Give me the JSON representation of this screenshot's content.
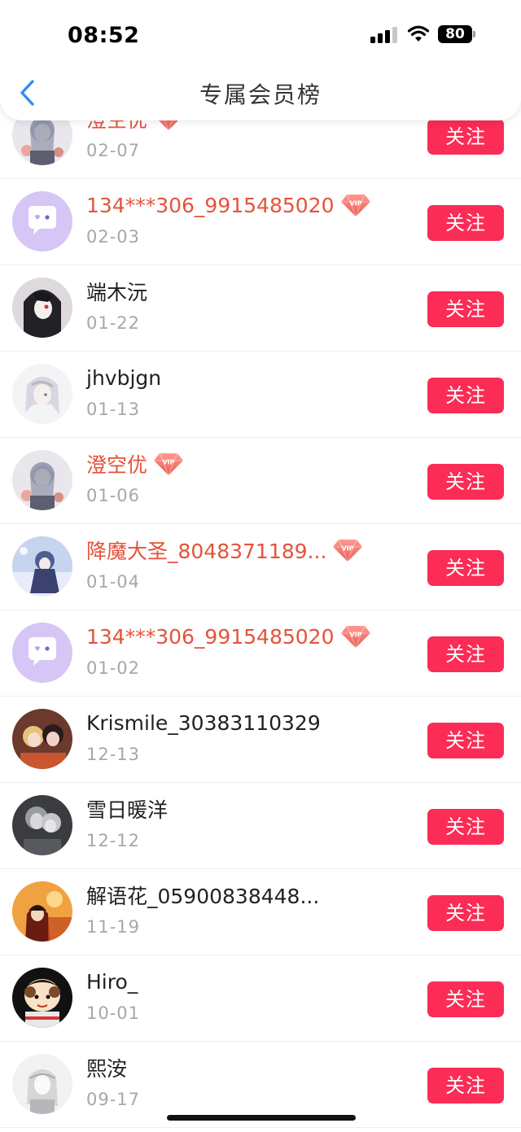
{
  "status_bar": {
    "time": "08:52",
    "battery": "80"
  },
  "header": {
    "title": "专属会员榜"
  },
  "follow_label": "关注",
  "vip_badge_text": "VIP",
  "colors": {
    "accent": "#fb2c55",
    "vip_name": "#e5533a",
    "back_arrow": "#2f8ff0"
  },
  "members": [
    {
      "name": "澄空优",
      "date": "02-07",
      "vip": true,
      "avatar": "anime-girl-silver"
    },
    {
      "name": "134***306_9915485020",
      "date": "02-03",
      "vip": true,
      "avatar": "default-chat"
    },
    {
      "name": "端木沅",
      "date": "01-22",
      "vip": false,
      "avatar": "anime-dark-hair"
    },
    {
      "name": "jhvbjgn",
      "date": "01-13",
      "vip": false,
      "avatar": "anime-white-hair"
    },
    {
      "name": "澄空优",
      "date": "01-06",
      "vip": true,
      "avatar": "anime-girl-silver"
    },
    {
      "name": "降魔大圣_8048371189...",
      "date": "01-04",
      "vip": true,
      "avatar": "anime-blue-scene"
    },
    {
      "name": "134***306_9915485020",
      "date": "01-02",
      "vip": true,
      "avatar": "default-chat"
    },
    {
      "name": "Krismile_30383110329",
      "date": "12-13",
      "vip": false,
      "avatar": "anime-duo"
    },
    {
      "name": "雪日暖洋",
      "date": "12-12",
      "vip": false,
      "avatar": "grey-couple"
    },
    {
      "name": "解语花_05900838448...",
      "date": "11-19",
      "vip": false,
      "avatar": "orange-sunset"
    },
    {
      "name": "Hiro_",
      "date": "10-01",
      "vip": false,
      "avatar": "cartoon-boy"
    },
    {
      "name": "熙洝",
      "date": "09-17",
      "vip": false,
      "avatar": "sketch-grey"
    }
  ]
}
